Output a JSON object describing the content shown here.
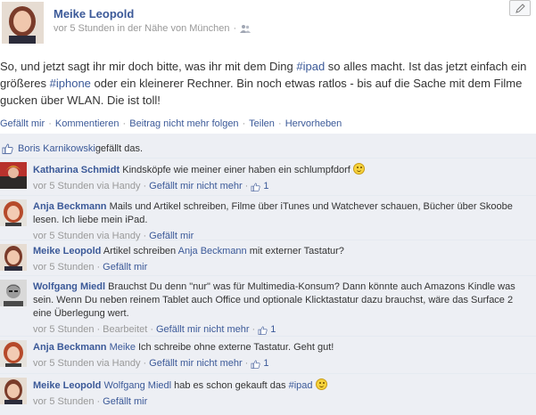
{
  "post": {
    "author": "Meike Leopold",
    "time": "vor 5 Stunden in der Nähe von München",
    "meta_sep": "·",
    "message_pre": "So, und jetzt sagt ihr mir doch bitte, was ihr mit dem Ding ",
    "hashtag1": "#ipad",
    "message_mid": " so alles macht. Ist das jetzt einfach ein größeres ",
    "hashtag2": "#iphone",
    "message_post": " oder ein kleinerer Rechner. Bin noch etwas ratlos - bis auf die Sache mit dem Filme gucken über WLAN. Die ist toll!"
  },
  "actions": {
    "like": "Gefällt mir",
    "comment": "Kommentieren",
    "unfollow": "Beitrag nicht mehr folgen",
    "share": "Teilen",
    "highlight": "Hervorheben",
    "sep": "·"
  },
  "likes": {
    "name": "Boris Karnikowski",
    "text": " gefällt das."
  },
  "comments": [
    {
      "author": "Katharina Schmidt",
      "tag": "",
      "text": "Kindsköpfe wie meiner einer haben ein schlumpfdorf",
      "text2": "",
      "emoji": true,
      "time": "vor 5 Stunden via Handy",
      "like_label": "Gefällt mir nicht mehr",
      "like_count": "1"
    },
    {
      "author": "Anja Beckmann",
      "tag": "",
      "text": "Mails und Artikel schreiben, Filme über iTunes und Watchever schauen, Bücher über Skoobe lesen. Ich liebe mein iPad.",
      "text2": "",
      "emoji": false,
      "time": "vor 5 Stunden via Handy",
      "like_label": "Gefällt mir",
      "like_count": ""
    },
    {
      "author": "Meike Leopold",
      "tag": "",
      "text": "Artikel schreiben ",
      "mention": "Anja Beckmann",
      "text2": " mit externer Tastatur?",
      "emoji": false,
      "time": "vor 5 Stunden",
      "like_label": "Gefällt mir",
      "like_count": ""
    },
    {
      "author": "Wolfgang Miedl",
      "tag": "",
      "text": "Brauchst Du denn \"nur\" was für Multimedia-Konsum? Dann könnte auch Amazons Kindle was sein. Wenn Du neben reinem Tablet auch Office und optionale Klicktastatur dazu brauchst, wäre das Surface 2 eine Überlegung wert.",
      "text2": "",
      "emoji": false,
      "time": "vor 5 Stunden",
      "edited": "Bearbeitet",
      "like_label": "Gefällt mir nicht mehr",
      "like_count": "1"
    },
    {
      "author": "Anja Beckmann",
      "tag": "Meike",
      "text": " Ich schreibe ohne externe Tastatur. Geht gut!",
      "text2": "",
      "emoji": false,
      "time": "vor 5 Stunden via Handy",
      "like_label": "Gefällt mir nicht mehr",
      "like_count": "1"
    },
    {
      "author": "Meike Leopold",
      "tag": "Wolfgang Miedl",
      "text": " hab es schon gekauft das ",
      "hashtag": "#ipad",
      "text2": "",
      "emoji": true,
      "time": "vor 5 Stunden",
      "like_label": "Gefällt mir",
      "like_count": ""
    }
  ],
  "colors": {
    "link": "#3b5998",
    "feedback_bg": "#edeff4",
    "meta": "#999999"
  }
}
